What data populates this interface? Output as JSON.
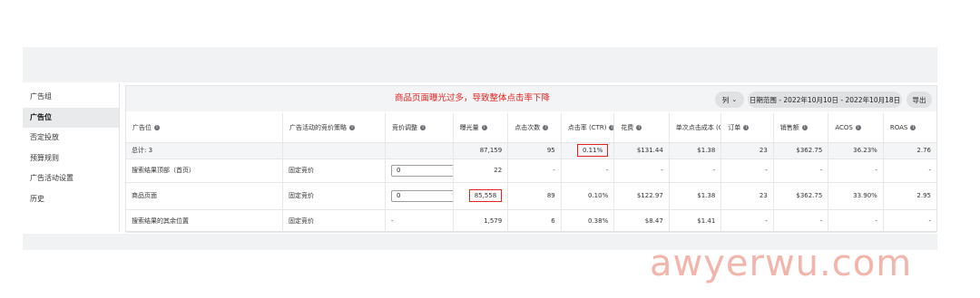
{
  "sidebar": {
    "items": [
      {
        "label": "广告组"
      },
      {
        "label": "广告位"
      },
      {
        "label": "否定投放"
      },
      {
        "label": "预算规则"
      },
      {
        "label": "广告活动设置"
      },
      {
        "label": "历史"
      }
    ]
  },
  "annotation": "商品页面曝光过多，导致整体点击率下降",
  "toolbar": {
    "columns_label": "列",
    "date_range_label": "日期范围 - 2022年10月10日 - 2022年10月18日",
    "export_label": "导出"
  },
  "table": {
    "headers": [
      "广告位",
      "广告活动的竞价策略",
      "竞价调整",
      "曝光量",
      "点击次数",
      "点击率 (CTR)",
      "花费",
      "单次点击成本 (CPC)",
      "订单",
      "销售额",
      "ACOS",
      "ROAS"
    ],
    "total": {
      "label": "总计: 3",
      "impressions": "87,159",
      "clicks": "95",
      "ctr": "0.11%",
      "spend": "$131.44",
      "cpc": "$1.38",
      "orders": "23",
      "sales": "$362.75",
      "acos": "36.23%",
      "roas": "2.76"
    },
    "rows": [
      {
        "placement": "搜索结果顶部（首页）",
        "strategy": "固定竞价",
        "bid_value": "0",
        "bid_unit": "%",
        "impressions": "22",
        "clicks": "-",
        "ctr": "-",
        "spend": "-",
        "cpc": "-",
        "orders": "-",
        "sales": "-",
        "acos": "-",
        "roas": "-"
      },
      {
        "placement": "商品页面",
        "strategy": "固定竞价",
        "bid_value": "0",
        "bid_unit": "%",
        "impressions": "85,558",
        "clicks": "89",
        "ctr": "0.10%",
        "spend": "$122.97",
        "cpc": "$1.38",
        "orders": "23",
        "sales": "$362.75",
        "acos": "33.90%",
        "roas": "2.95"
      },
      {
        "placement": "搜索结果的其余位置",
        "strategy": "固定竞价",
        "bid_value": "-",
        "impressions": "1,579",
        "clicks": "6",
        "ctr": "0.38%",
        "spend": "$8.47",
        "cpc": "$1.41",
        "orders": "-",
        "sales": "-",
        "acos": "-",
        "roas": "-"
      }
    ]
  },
  "watermark": "awyerwu.com",
  "colors": {
    "highlight": "#e0231f",
    "watermark": "#f2b5ac"
  }
}
